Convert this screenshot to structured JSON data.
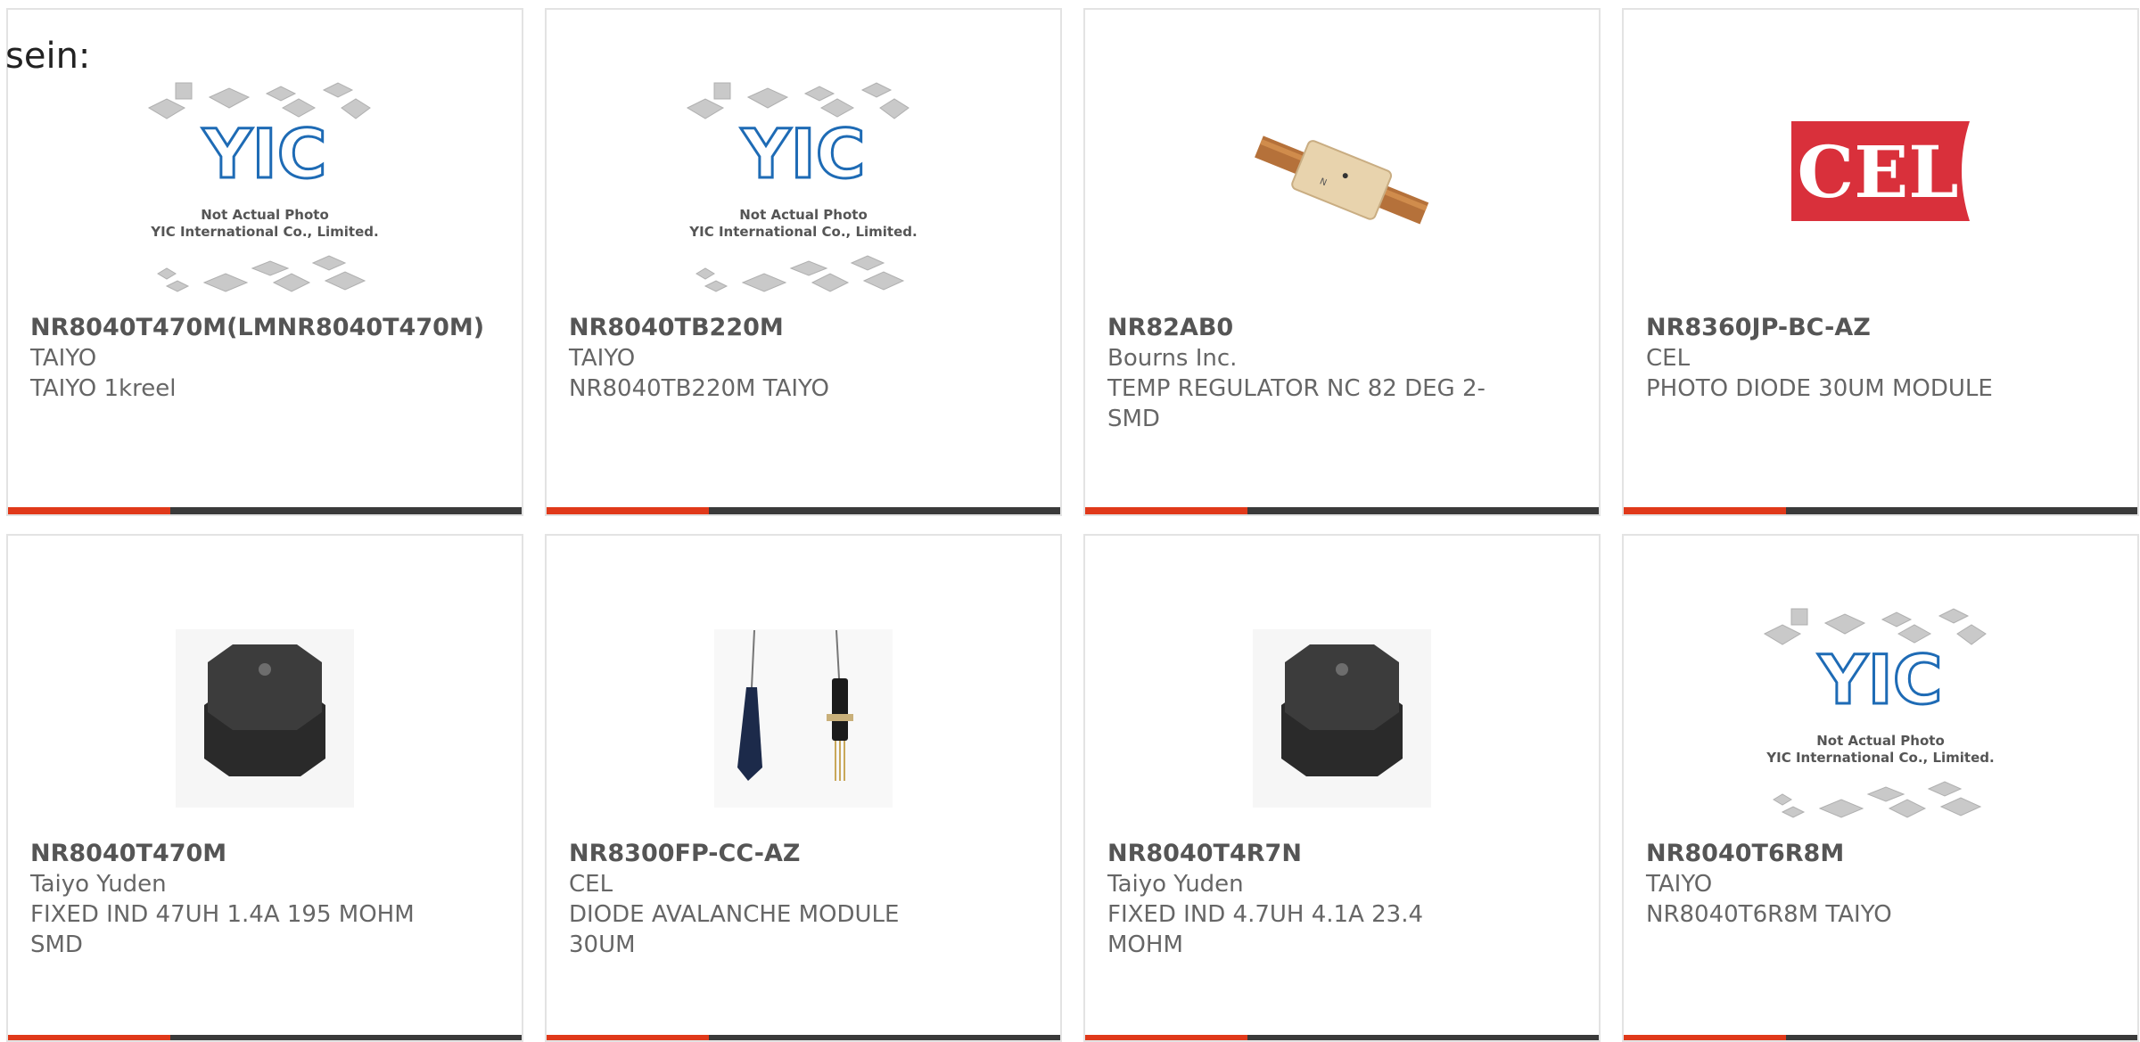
{
  "intro_text": "sein:",
  "products": [
    {
      "part": "NR8040T470M(LMNR8040T470M)",
      "maker": "TAIYO",
      "desc": "TAIYO 1kreel",
      "image": "yic-placeholder"
    },
    {
      "part": "NR8040TB220M",
      "maker": "TAIYO",
      "desc": "NR8040TB220M TAIYO",
      "image": "yic-placeholder"
    },
    {
      "part": "NR82AB0",
      "maker": "Bourns Inc.",
      "desc": "TEMP REGULATOR NC 82 DEG 2-SMD",
      "image": "thermal-fuse-photo"
    },
    {
      "part": "NR8360JP-BC-AZ",
      "maker": "CEL",
      "desc": "PHOTO DIODE 30UM MODULE",
      "image": "cel-logo"
    },
    {
      "part": "NR8040T470M",
      "maker": "Taiyo Yuden",
      "desc": "FIXED IND 47UH 1.4A 195 MOHM SMD",
      "image": "inductor-photo"
    },
    {
      "part": "NR8300FP-CC-AZ",
      "maker": "CEL",
      "desc": "DIODE AVALANCHE MODULE 30UM",
      "image": "fiber-module-photo"
    },
    {
      "part": "NR8040T4R7N",
      "maker": "Taiyo Yuden",
      "desc": "FIXED IND 4.7UH 4.1A 23.4 MOHM",
      "image": "inductor-photo"
    },
    {
      "part": "NR8040T6R8M",
      "maker": "TAIYO",
      "desc": "NR8040T6R8M TAIYO",
      "image": "yic-placeholder"
    }
  ],
  "placeholder": {
    "logo_text": "YIC",
    "line1": "Not Actual Photo",
    "line2": "YIC International Co., Limited."
  },
  "cel_logo_text": "CEL",
  "colors": {
    "accent": "#e0391a",
    "bar": "#3a3a3a",
    "brand_blue": "#1e6bb5",
    "cel_red": "#d9303b"
  }
}
